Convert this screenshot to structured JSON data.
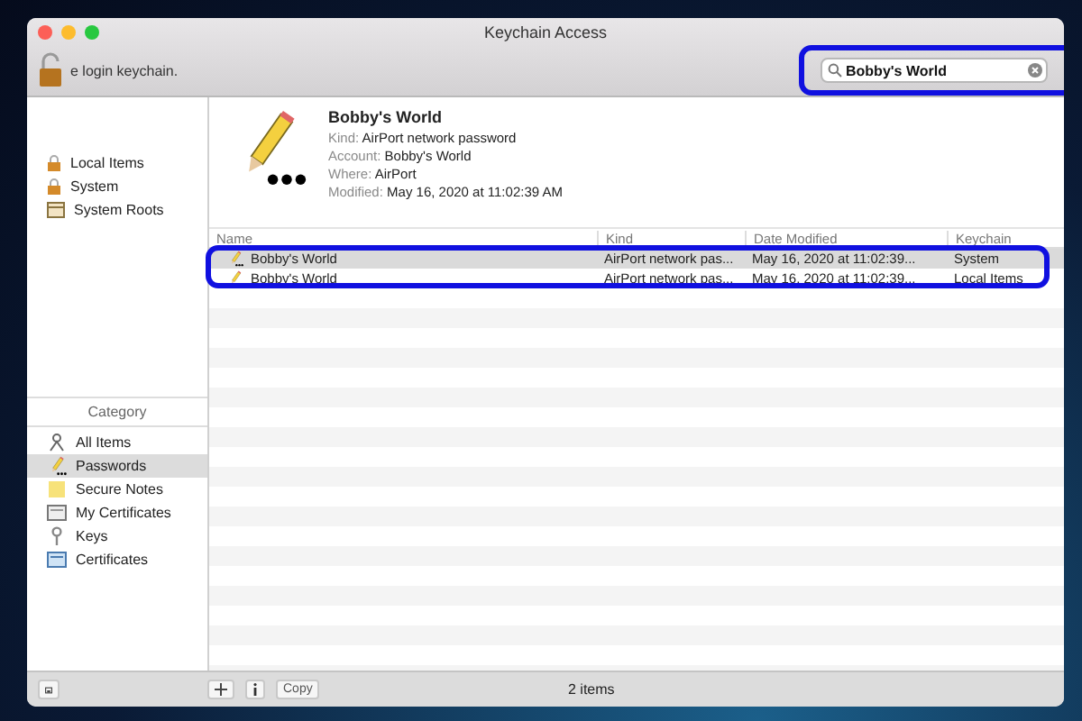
{
  "window": {
    "title": "Keychain Access"
  },
  "toolbar": {
    "lock_hint": "e login keychain.",
    "search": {
      "value": "Bobby's World"
    }
  },
  "keychains": [
    {
      "label": "Local Items",
      "selected": false
    },
    {
      "label": "System",
      "selected": false
    },
    {
      "label": "System Roots",
      "selected": false
    }
  ],
  "category": {
    "title": "Category",
    "items": [
      {
        "label": "All Items",
        "kind": "all",
        "selected": false
      },
      {
        "label": "Passwords",
        "kind": "password",
        "selected": true
      },
      {
        "label": "Secure Notes",
        "kind": "note",
        "selected": false
      },
      {
        "label": "My Certificates",
        "kind": "mycert",
        "selected": false
      },
      {
        "label": "Keys",
        "kind": "key",
        "selected": false
      },
      {
        "label": "Certificates",
        "kind": "cert",
        "selected": false
      }
    ]
  },
  "detail": {
    "name": "Bobby's World",
    "fields": [
      {
        "label": "Kind:",
        "value": "AirPort network password"
      },
      {
        "label": "Account:",
        "value": "Bobby's World"
      },
      {
        "label": "Where:",
        "value": "AirPort"
      },
      {
        "label": "Modified:",
        "value": "May 16, 2020 at 11:02:39 AM"
      }
    ]
  },
  "table": {
    "columns": [
      "Name",
      "Kind",
      "Date Modified",
      "Keychain"
    ],
    "rows": [
      {
        "cells": [
          "Bobby's World",
          "AirPort network pas...",
          "May 16, 2020 at 11:02:39...",
          "System"
        ],
        "selected": true
      },
      {
        "cells": [
          "Bobby's World",
          "AirPort network pas...",
          "May 16, 2020 at 11:02:39...",
          "Local Items"
        ],
        "selected": false
      }
    ]
  },
  "bottom_bar": {
    "copy": "Copy",
    "count": "2 items"
  }
}
